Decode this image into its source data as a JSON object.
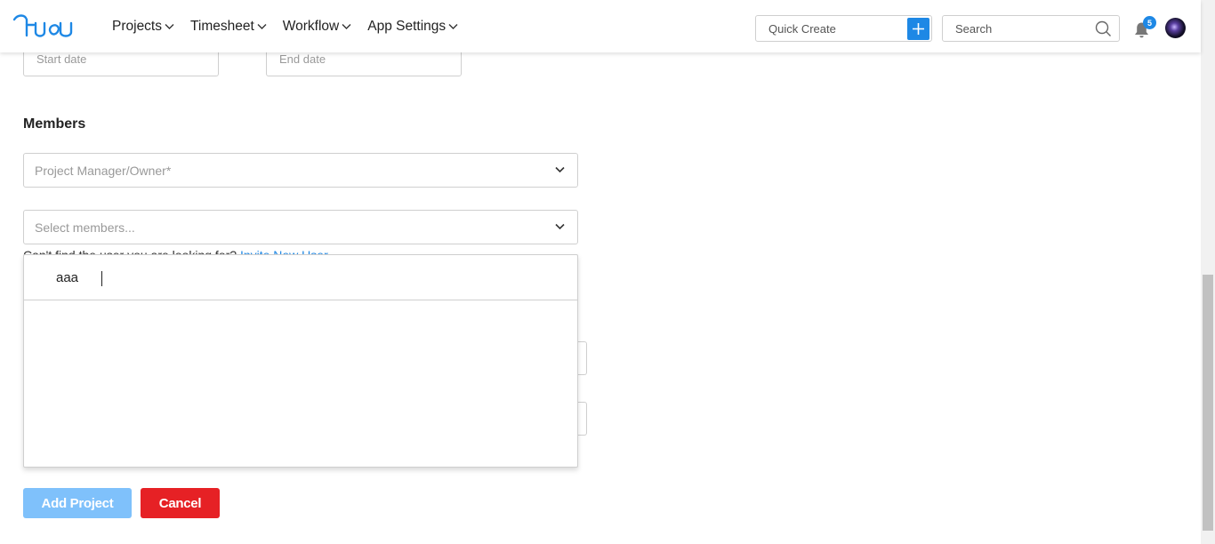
{
  "nav": {
    "items": [
      {
        "label": "Projects"
      },
      {
        "label": "Timesheet"
      },
      {
        "label": "Workflow"
      },
      {
        "label": "App Settings"
      }
    ]
  },
  "header": {
    "quick_create_placeholder": "Quick Create",
    "search_placeholder": "Search",
    "notification_count": "5"
  },
  "form": {
    "start_date_placeholder": "Start date",
    "end_date_placeholder": "End date",
    "members_title": "Members",
    "manager_placeholder": "Project Manager/Owner*",
    "members_placeholder": "Select members...",
    "hint_text": "Can't find the user you are looking for?",
    "hint_link": "Invite New User"
  },
  "dropdown": {
    "search_value": "aaa"
  },
  "actions": {
    "add_label": "Add Project",
    "cancel_label": "Cancel"
  },
  "colors": {
    "accent": "#1e88e5",
    "add_button": "#7fc1fb",
    "cancel_button": "#e62125"
  }
}
